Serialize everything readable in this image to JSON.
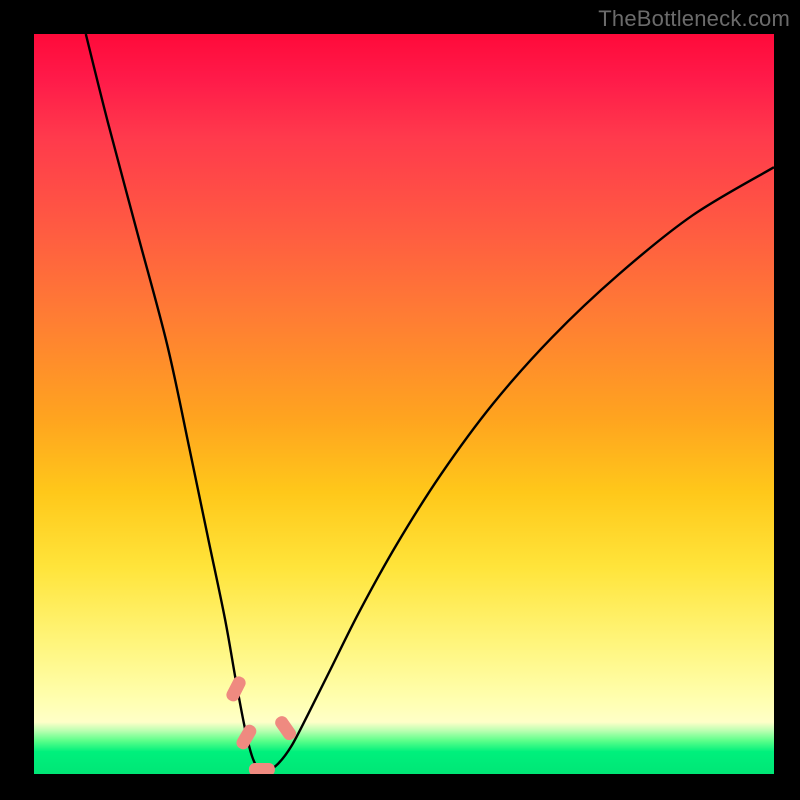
{
  "watermark": "TheBottleneck.com",
  "chart_data": {
    "type": "line",
    "title": "",
    "xlabel": "",
    "ylabel": "",
    "xlim": [
      0,
      100
    ],
    "ylim": [
      0,
      100
    ],
    "series": [
      {
        "name": "bottleneck-curve",
        "x": [
          7,
          10,
          14,
          18,
          21,
          23.5,
          25.8,
          27.3,
          28.5,
          29.5,
          30.5,
          31.5,
          33,
          34.8,
          37,
          40,
          44,
          49,
          55,
          62,
          70,
          79,
          89,
          100
        ],
        "values": [
          100,
          88,
          73,
          58,
          44,
          32,
          21,
          12.5,
          6.2,
          2.3,
          0.5,
          0.4,
          1.4,
          3.8,
          8,
          14,
          22,
          31,
          40.5,
          50,
          59,
          67.5,
          75.5,
          82
        ]
      }
    ],
    "markers": [
      {
        "name": "left-knee-top",
        "x": 27.3,
        "y": 11.5,
        "rotation": -63
      },
      {
        "name": "left-knee-bottom",
        "x": 28.7,
        "y": 5.0,
        "rotation": -60
      },
      {
        "name": "valley-bottom",
        "x": 30.8,
        "y": 0.6,
        "rotation": 0
      },
      {
        "name": "right-knee",
        "x": 34.0,
        "y": 6.2,
        "rotation": 55
      }
    ],
    "colors": {
      "curve": "#000000",
      "marker_fill": "#ef8a80",
      "marker_stroke": "#d86b60"
    }
  }
}
